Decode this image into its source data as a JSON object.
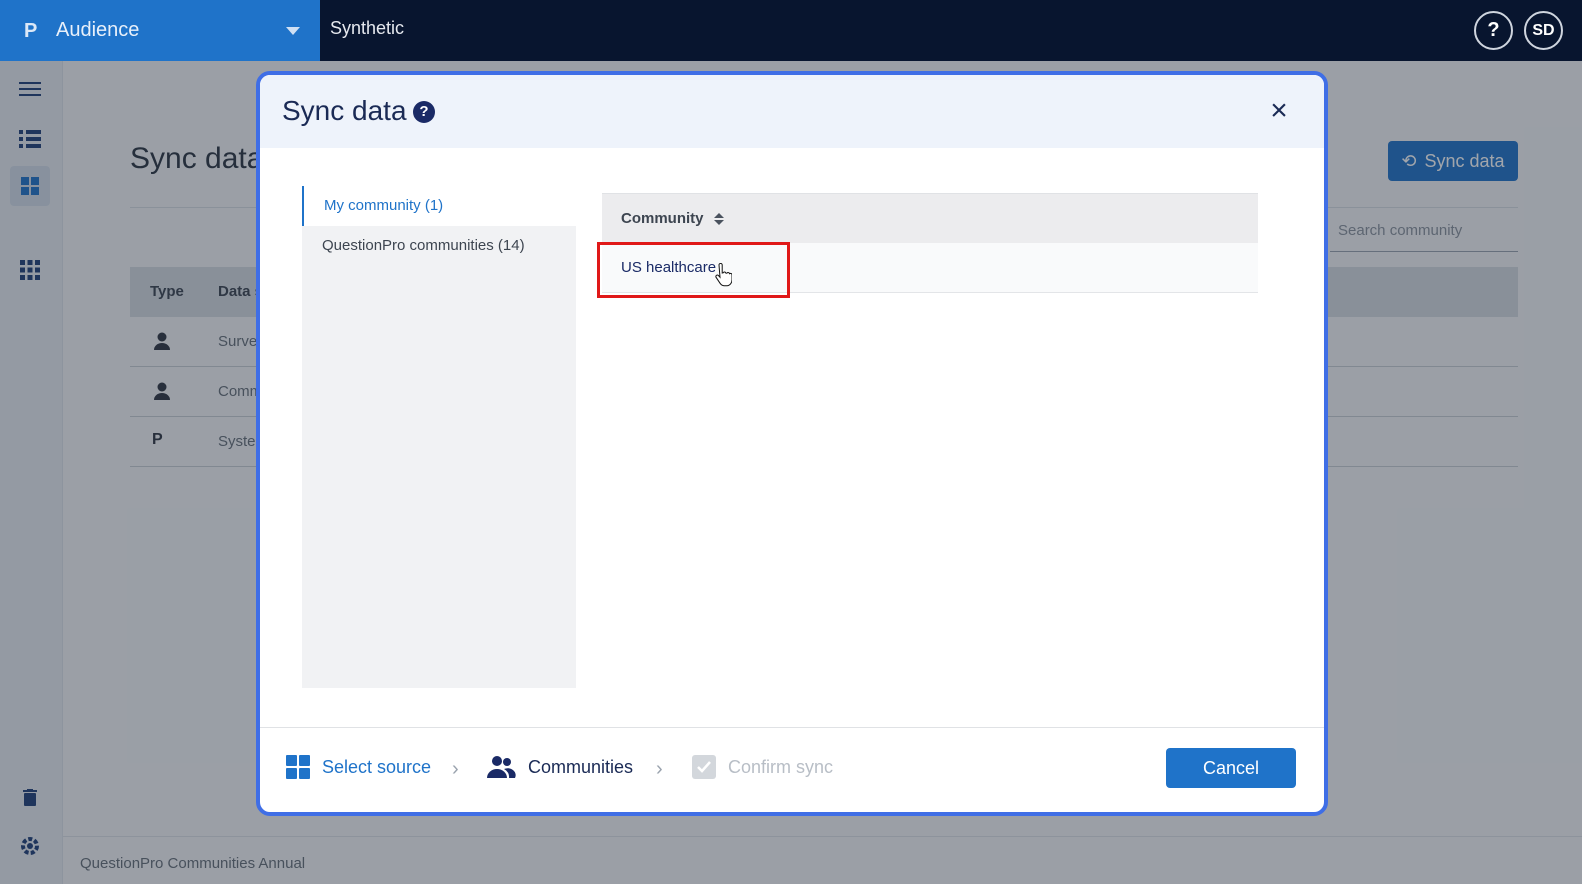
{
  "topbar": {
    "app_logo": "P",
    "app_name": "Audience",
    "project_name": "Synthetic",
    "help_label": "?",
    "avatar_initials": "SD"
  },
  "page": {
    "title": "Sync data",
    "sync_button": "Sync data",
    "search_placeholder": "Search community",
    "table_headers": [
      "Type",
      "Data s"
    ],
    "rows": [
      {
        "icon": "person-icon",
        "text": "Survey"
      },
      {
        "icon": "person-icon",
        "text": "Comm"
      },
      {
        "icon": "questionpro-logo-icon",
        "text": "System"
      }
    ],
    "footer": "QuestionPro Communities Annual"
  },
  "modal": {
    "title": "Sync data",
    "help": "?",
    "close": "×",
    "source_tabs": [
      {
        "label": "My community (1)",
        "active": true
      },
      {
        "label": "QuestionPro communities (14)",
        "active": false
      }
    ],
    "table": {
      "column": "Community",
      "rows": [
        "US healthcare"
      ]
    },
    "steps": [
      {
        "label": "Select source",
        "state": "done"
      },
      {
        "label": "Communities",
        "state": "current"
      },
      {
        "label": "Confirm sync",
        "state": "disabled"
      }
    ],
    "cancel": "Cancel"
  },
  "colors": {
    "primary": "#1f73c9",
    "topbar": "#08152f",
    "modal_border": "#3f6ee6",
    "highlight": "#e01818"
  }
}
